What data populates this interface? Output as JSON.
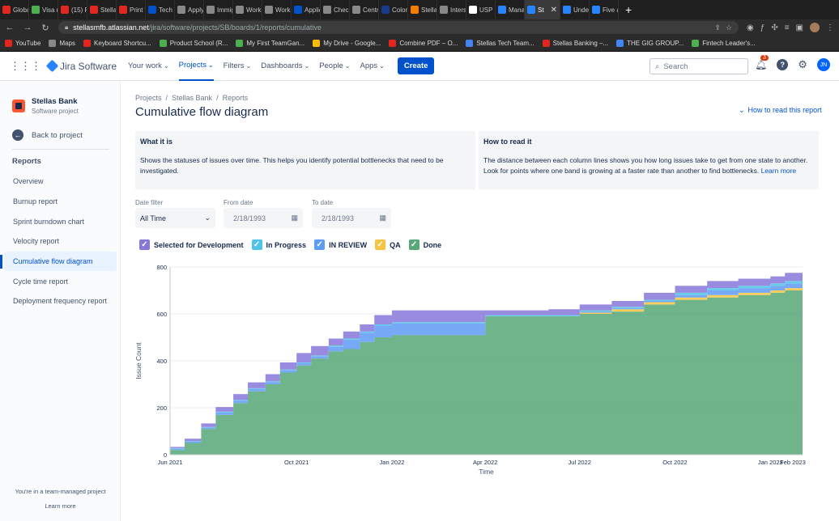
{
  "browser": {
    "tabs": [
      {
        "label": "Globa",
        "color": "#E2261F"
      },
      {
        "label": "Visa r",
        "color": "#4CAF50"
      },
      {
        "label": "(15) P",
        "color": "#E2261F"
      },
      {
        "label": "Stella",
        "color": "#E2261F"
      },
      {
        "label": "Print V",
        "color": "#E2261F"
      },
      {
        "label": "Tech t",
        "color": "#0052CC"
      },
      {
        "label": "Apply",
        "color": "#888888"
      },
      {
        "label": "Immig",
        "color": "#888888"
      },
      {
        "label": "Work",
        "color": "#888888"
      },
      {
        "label": "Work",
        "color": "#888888"
      },
      {
        "label": "Applic",
        "color": "#0052CC"
      },
      {
        "label": "Check",
        "color": "#888888"
      },
      {
        "label": "Centr",
        "color": "#888888"
      },
      {
        "label": "Colon",
        "color": "#1a3a8a"
      },
      {
        "label": "Stella",
        "color": "#F57C00"
      },
      {
        "label": "Inters",
        "color": "#888888"
      },
      {
        "label": "USP -",
        "color": "#ffffff"
      },
      {
        "label": "Mana",
        "color": "#2684FF"
      },
      {
        "label": "St",
        "color": "#2684FF",
        "active": true
      },
      {
        "label": "Under",
        "color": "#2684FF"
      },
      {
        "label": "Five a",
        "color": "#2684FF"
      }
    ],
    "tab_close": "✕",
    "new_tab": "+",
    "url_host": "stellasmfb.atlassian.net",
    "url_path": "/jira/software/projects/SB/boards/1/reports/cumulative",
    "bookmarks": [
      {
        "label": "YouTube",
        "color": "#E2261F"
      },
      {
        "label": "Maps",
        "color": "#888888"
      },
      {
        "label": "Keyboard Shortcu...",
        "color": "#E2261F"
      },
      {
        "label": "Product School (R...",
        "color": "#4CAF50"
      },
      {
        "label": "My First TeamGan...",
        "color": "#4CAF50"
      },
      {
        "label": "My Drive - Google...",
        "color": "#FBBC04"
      },
      {
        "label": "Combine PDF – O...",
        "color": "#E2261F"
      },
      {
        "label": "Stellas Tech Team...",
        "color": "#4285F4"
      },
      {
        "label": "Stellas Banking –...",
        "color": "#E2261F"
      },
      {
        "label": "THE GIG GROUP...",
        "color": "#4285F4"
      },
      {
        "label": "Fintech Leader's...",
        "color": "#4CAF50"
      }
    ]
  },
  "topnav": {
    "product": "Jira Software",
    "items": [
      {
        "label": "Your work",
        "active": false
      },
      {
        "label": "Projects",
        "active": true
      },
      {
        "label": "Filters",
        "active": false
      },
      {
        "label": "Dashboards",
        "active": false
      },
      {
        "label": "People",
        "active": false
      },
      {
        "label": "Apps",
        "active": false
      }
    ],
    "create_label": "Create",
    "search_placeholder": "Search",
    "notification_count": "3",
    "help_label": "?",
    "user_initials": "JN"
  },
  "sidebar": {
    "project_name": "Stellas Bank",
    "project_type": "Software project",
    "back_label": "Back to project",
    "section_heading": "Reports",
    "items": [
      {
        "label": "Overview",
        "active": false
      },
      {
        "label": "Burnup report",
        "active": false
      },
      {
        "label": "Sprint burndown chart",
        "active": false
      },
      {
        "label": "Velocity report",
        "active": false
      },
      {
        "label": "Cumulative flow diagram",
        "active": true
      },
      {
        "label": "Cycle time report",
        "active": false
      },
      {
        "label": "Deployment frequency report",
        "active": false
      }
    ],
    "footer_text": "You're in a team-managed project",
    "footer_link": "Learn more"
  },
  "page": {
    "breadcrumbs": [
      "Projects",
      "Stellas Bank",
      "Reports"
    ],
    "crumb_sep": "/",
    "title": "Cumulative flow diagram",
    "howto_link": "How to read this report",
    "what_heading": "What it is",
    "what_text": "Shows the statuses of issues over time. This helps you identify potential bottlenecks that need to be investigated.",
    "how_heading": "How to read it",
    "how_text": "The distance between each column lines shows you how long issues take to get from one state to another. Look for points where one band is growing at a faster rate than another to find bottlenecks.",
    "how_link": "Learn more",
    "date_filter_label": "Date filter",
    "date_filter_value": "All Time",
    "from_label": "From date",
    "from_value": "2/18/1993",
    "to_label": "To date",
    "to_value": "2/18/1993"
  },
  "legend": [
    {
      "label": "Selected for Development",
      "color": "#8777D9"
    },
    {
      "label": "In Progress",
      "color": "#4FC3E8"
    },
    {
      "label": "IN REVIEW",
      "color": "#5E9BF5"
    },
    {
      "label": "QA",
      "color": "#F5C542"
    },
    {
      "label": "Done",
      "color": "#57A778"
    }
  ],
  "chart_data": {
    "type": "area",
    "stacked": true,
    "xlabel": "Time",
    "ylabel": "Issue Count",
    "ylim": [
      0,
      800
    ],
    "yticks": [
      0,
      200,
      400,
      600,
      800
    ],
    "xticks": [
      "Jun 2021",
      "Oct 2021",
      "Jan 2022",
      "Apr 2022",
      "Jul 2022",
      "Oct 2022",
      "Jan 2023",
      "Feb 2023"
    ],
    "x": [
      "2021-06-01",
      "2021-06-15",
      "2021-07-01",
      "2021-07-15",
      "2021-08-01",
      "2021-08-15",
      "2021-09-01",
      "2021-09-15",
      "2021-10-01",
      "2021-10-15",
      "2021-11-01",
      "2021-11-15",
      "2021-12-01",
      "2021-12-15",
      "2022-01-01",
      "2022-02-01",
      "2022-03-01",
      "2022-04-01",
      "2022-05-01",
      "2022-06-01",
      "2022-07-01",
      "2022-08-01",
      "2022-09-01",
      "2022-10-01",
      "2022-11-01",
      "2022-12-01",
      "2023-01-01",
      "2023-01-15",
      "2023-02-01"
    ],
    "series": [
      {
        "name": "Done",
        "color": "#57A778",
        "values": [
          20,
          50,
          110,
          170,
          220,
          270,
          300,
          350,
          380,
          410,
          440,
          450,
          480,
          500,
          510,
          510,
          510,
          590,
          590,
          590,
          600,
          610,
          640,
          660,
          670,
          680,
          690,
          700,
          710
        ]
      },
      {
        "name": "QA",
        "color": "#F5C542",
        "values": [
          0,
          0,
          0,
          0,
          0,
          0,
          0,
          0,
          0,
          0,
          0,
          0,
          0,
          0,
          0,
          0,
          0,
          0,
          0,
          0,
          5,
          10,
          10,
          10,
          10,
          10,
          10,
          10,
          15
        ]
      },
      {
        "name": "IN REVIEW",
        "color": "#5E9BF5",
        "values": [
          5,
          5,
          5,
          10,
          10,
          10,
          10,
          10,
          10,
          10,
          20,
          40,
          40,
          50,
          50,
          50,
          50,
          0,
          0,
          0,
          5,
          5,
          5,
          10,
          20,
          20,
          20,
          20,
          10
        ]
      },
      {
        "name": "In Progress",
        "color": "#4FC3E8",
        "values": [
          3,
          3,
          3,
          3,
          3,
          3,
          3,
          3,
          3,
          3,
          5,
          5,
          5,
          5,
          5,
          5,
          5,
          5,
          5,
          5,
          5,
          5,
          5,
          10,
          10,
          10,
          10,
          10,
          15
        ]
      },
      {
        "name": "Selected for Development",
        "color": "#8777D9",
        "values": [
          5,
          10,
          15,
          20,
          25,
          25,
          30,
          30,
          40,
          40,
          30,
          30,
          30,
          40,
          50,
          50,
          50,
          20,
          20,
          25,
          25,
          25,
          30,
          30,
          30,
          30,
          30,
          35,
          40
        ]
      }
    ]
  }
}
